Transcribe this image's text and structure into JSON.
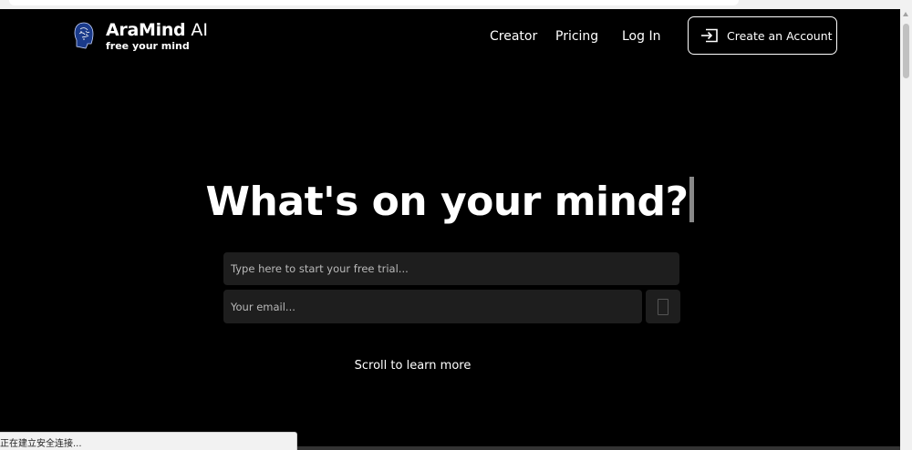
{
  "brand": {
    "name": "AraMind",
    "suffix": "AI",
    "tagline": "free your mind",
    "logo_icon": "brain-head-icon"
  },
  "nav": {
    "items": [
      {
        "label": "Creator"
      },
      {
        "label": "Pricing"
      },
      {
        "label": "Log In"
      }
    ],
    "cta": {
      "label": "Create an Account",
      "icon": "sign-in-icon"
    }
  },
  "hero": {
    "title": "What's on your mind?"
  },
  "form": {
    "prompt_placeholder": "Type here to start your free trial...",
    "email_placeholder": "Your email...",
    "submit_icon": "submit-icon"
  },
  "footer": {
    "scroll_hint": "Scroll to learn more"
  },
  "browser": {
    "status_text": "正在建立安全连接..."
  },
  "colors": {
    "background": "#000000",
    "input_bg": "#1e1e1e",
    "text": "#ffffff",
    "placeholder": "#b9b9b9",
    "logo_blue": "#1a3a8a"
  }
}
